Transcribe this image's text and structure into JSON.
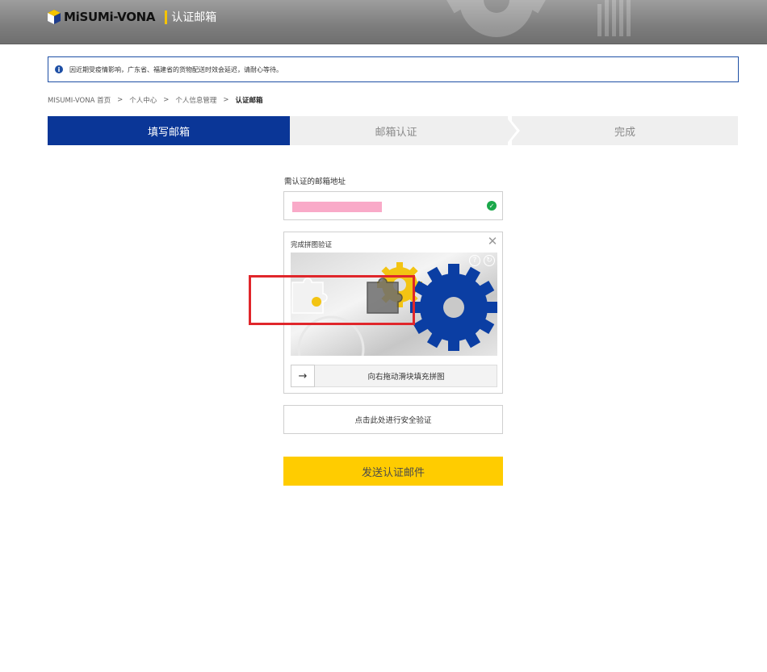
{
  "header": {
    "logo_text": "MiSUMi-VONA",
    "page_title": "认证邮箱"
  },
  "notice": {
    "text": "因近期受疫情影响，广东省、福建省的货物配送时效会延迟，请耐心等待。"
  },
  "breadcrumb": {
    "items": [
      "MISUMI-VONA 首页",
      "个人中心",
      "个人信息管理"
    ],
    "separator": ">",
    "current": "认证邮箱"
  },
  "steps": [
    {
      "label": "填写邮箱",
      "active": true
    },
    {
      "label": "邮箱认证",
      "active": false
    },
    {
      "label": "完成",
      "active": false
    }
  ],
  "form": {
    "email_label": "需认证的邮箱地址",
    "email_valid": true
  },
  "captcha": {
    "title": "完成拼图验证",
    "slider_text": "向右拖动滑块填充拼图"
  },
  "buttons": {
    "security_verify": "点击此处进行安全验证",
    "send_mail": "发送认证邮件"
  },
  "colors": {
    "brand_blue": "#0a3697",
    "accent_yellow": "#ffcc00",
    "highlight_red": "#e0262b",
    "success_green": "#1aa84a"
  }
}
